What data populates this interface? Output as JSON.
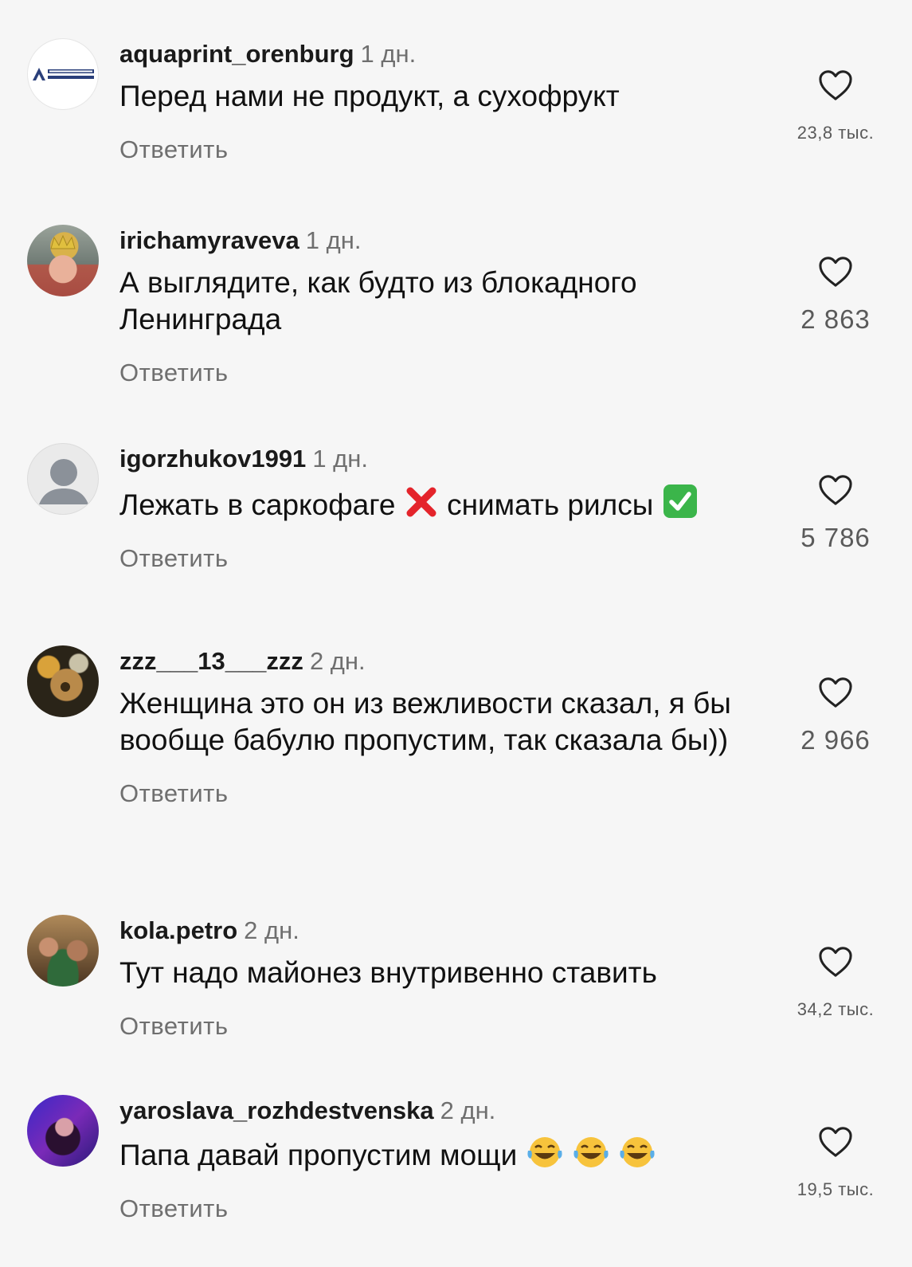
{
  "reply_label": "Ответить",
  "comments": [
    {
      "username": "aquaprint_orenburg",
      "time": "1 дн.",
      "text": "Перед нами не продукт, а сухофрукт",
      "likes": "23,8 тыс.",
      "avatar_text": "АКВАПРИНТ ОРЕНБУРГ"
    },
    {
      "username": "irichamyraveva",
      "time": "1 дн.",
      "text": "А выглядите, как будто из блокадного Ленинграда",
      "likes": "2 863"
    },
    {
      "username": "igorzhukov1991",
      "time": "1 дн.",
      "text_a": "Лежать в саркофаге",
      "text_b": "снимать рилсы",
      "likes": "5 786"
    },
    {
      "username": "zzz___13___zzz",
      "time": "2 дн.",
      "text": "Женщина это он из вежливости сказал, я бы вообще бабулю пропустим, так сказала бы))",
      "likes": "2 966"
    },
    {
      "username": "kola.petro",
      "time": "2 дн.",
      "text": "Тут надо майонез внутривенно ставить",
      "likes": "34,2 тыс."
    },
    {
      "username": "yaroslava_rozhdestvenska",
      "time": "2 дн.",
      "text": "Папа давай пропустим мощи",
      "likes": "19,5 тыс."
    }
  ],
  "colors": {
    "background": "#f6f6f6",
    "text": "#111111",
    "secondary": "#6f6f6f",
    "cross": "#e4242b",
    "check": "#3bb54a",
    "emoji": "#f7c33c"
  }
}
